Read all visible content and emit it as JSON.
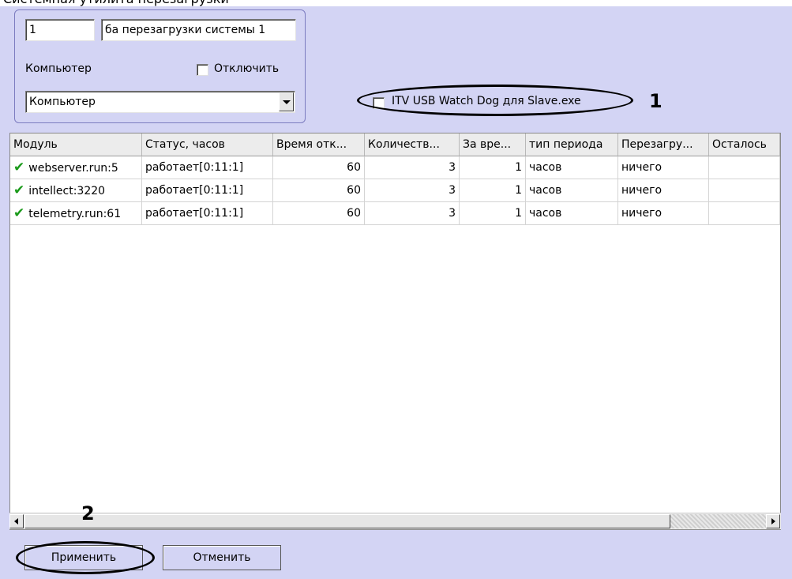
{
  "doc_caption": "Системная утилита перезагрузки",
  "settings": {
    "id_value": "1",
    "name_value": "ба перезагрузки системы 1",
    "computer_label": "Компьютер",
    "disable_label": "Отключить",
    "computer_select": "Компьютер",
    "usb_watchdog_label": "ITV USB Watch Dog для Slave.exe"
  },
  "callouts": {
    "one": "1",
    "two": "2"
  },
  "table": {
    "columns": [
      "Модуль",
      "Статус, часов",
      "Время отк...",
      "Количеств...",
      "За вре...",
      "тип периода",
      "Перезагру...",
      "Осталось"
    ],
    "rows": [
      [
        "webserver.run:5",
        "работает[0:11:1]",
        "60",
        "3",
        "1",
        "часов",
        "ничего",
        ""
      ],
      [
        "intellect:3220",
        "работает[0:11:1]",
        "60",
        "3",
        "1",
        "часов",
        "ничего",
        ""
      ],
      [
        "telemetry.run:61",
        "работает[0:11:1]",
        "60",
        "3",
        "1",
        "часов",
        "ничего",
        ""
      ]
    ]
  },
  "buttons": {
    "apply": "Применить",
    "cancel": "Отменить"
  },
  "colors": {
    "panel": "#d3d4f4",
    "check": "#1a9a1a"
  }
}
